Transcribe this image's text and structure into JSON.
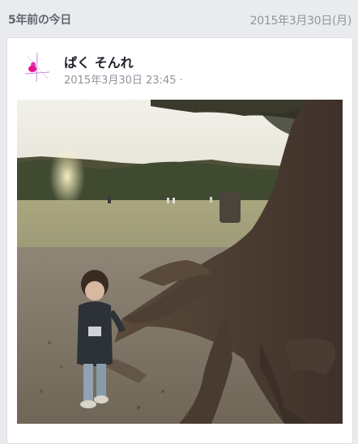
{
  "header": {
    "label": "5年前の今日",
    "date": "2015年3月30日(月)"
  },
  "post": {
    "author": "ぱく そんれ",
    "timestamp": "2015年3月30日 23:45 ·",
    "photo": {
      "description_icon": "photo-image"
    }
  },
  "colors": {
    "background": "#e9ebee",
    "card": "#ffffff",
    "author": "#1d2129",
    "meta": "#90949c",
    "avatar_accent": "#e8138c"
  }
}
